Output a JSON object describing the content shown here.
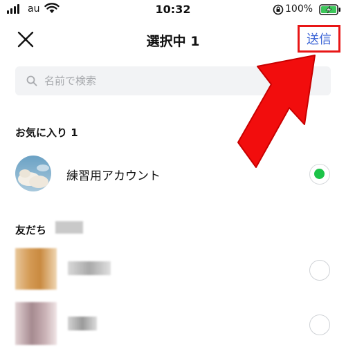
{
  "status_bar": {
    "carrier": "au",
    "time": "10:32",
    "battery_percent": "100%"
  },
  "header": {
    "title": "選択中 1",
    "send_label": "送信"
  },
  "search": {
    "placeholder": "名前で検索"
  },
  "favorites": {
    "header": "お気に入り 1",
    "items": [
      {
        "name": "練習用アカウント",
        "selected": true
      }
    ]
  },
  "friends": {
    "header": "友だち",
    "items": [
      {
        "selected": false
      },
      {
        "selected": false
      }
    ]
  },
  "colors": {
    "accent_blue": "#3b64d6",
    "selected_green": "#1cc348",
    "highlight_red": "#e81616"
  },
  "icons": [
    "signal-icon",
    "wifi-icon",
    "orientation-lock-icon",
    "battery-charging-icon",
    "close-icon",
    "search-icon",
    "arrow-annotation"
  ]
}
